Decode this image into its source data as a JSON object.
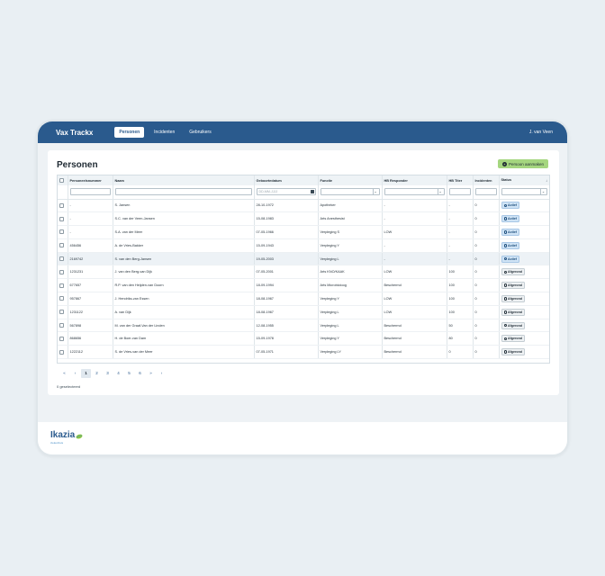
{
  "header": {
    "brand": "Vax Trackx",
    "tabs": [
      {
        "label": "Personen",
        "active": true
      },
      {
        "label": "Incidenten",
        "active": false
      },
      {
        "label": "Gebruikers",
        "active": false
      }
    ],
    "user": "J. van Veen"
  },
  "page": {
    "title": "Personen",
    "add_button": "Persoon aanmaken"
  },
  "table": {
    "columns": [
      "Personeelsnummer",
      "Naam",
      "Geboortedatum",
      "Functie",
      "HB Responder",
      "HB Titer",
      "Incidenten",
      "Status"
    ],
    "filters": {
      "date_placeholder": "DD-MM-JJJJ"
    },
    "rows": [
      {
        "nr": "-",
        "naam": "S. Jansen",
        "geb": "28-10-1972",
        "functie": "Apotheker",
        "hb": "-",
        "titer": "-",
        "inc": "0",
        "status": "Actief"
      },
      {
        "nr": "-",
        "naam": "S.C. van der Veen-Jansen",
        "geb": "15-08-1983",
        "functie": "Arts Anesthesist",
        "hb": "-",
        "titer": "-",
        "inc": "0",
        "status": "Actief"
      },
      {
        "nr": "-",
        "naam": "S.A. van der Meer",
        "geb": "07-05-1966",
        "functie": "Verpleging S",
        "hb": "LOW",
        "titer": "-",
        "inc": "0",
        "status": "Actief"
      },
      {
        "nr": "456456",
        "naam": "A. de Vries-Bakker",
        "geb": "15-09-1943",
        "functie": "Verpleging Y",
        "hb": "-",
        "titer": "-",
        "inc": "0",
        "status": "Actief"
      },
      {
        "nr": "2169742",
        "naam": "S. van den Berg-Jansen",
        "geb": "19-05-2003",
        "functie": "Verpleging L",
        "hb": "-",
        "titer": "-",
        "inc": "0",
        "status": "Actief"
      },
      {
        "nr": "1231231",
        "naam": "J. van den Berg-van Dijk",
        "geb": "07-05-2001",
        "functie": "Arts KNO/KAAK",
        "hb": "LOW",
        "titer": "100",
        "inc": "0",
        "status": "Afgerond"
      },
      {
        "nr": "677657",
        "naam": "R.P. van den Heijden-van Doorn",
        "geb": "18-09-1994",
        "functie": "Arts Microbioloog",
        "hb": "Beschermd",
        "titer": "100",
        "inc": "0",
        "status": "Afgerond"
      },
      {
        "nr": "957867",
        "naam": "J. Hendriks-van Essen",
        "geb": "18-08-1967",
        "functie": "Verpleging Y",
        "hb": "LOW",
        "titer": "100",
        "inc": "0",
        "status": "Afgerond"
      },
      {
        "nr": "1231122",
        "naam": "A. van Dijk",
        "geb": "18-08-1967",
        "functie": "Verpleging L",
        "hb": "LOW",
        "titer": "100",
        "inc": "0",
        "status": "Afgerond"
      },
      {
        "nr": "567898",
        "naam": "M. van der Graaf-Van der Linden",
        "geb": "12-08-1955",
        "functie": "Verpleging L",
        "hb": "Beschermd",
        "titer": "50",
        "inc": "0",
        "status": "Afgerond"
      },
      {
        "nr": "868656",
        "naam": "H. de Boer-van Dam",
        "geb": "15-09-1978",
        "functie": "Verpleging Y",
        "hb": "Beschermd",
        "titer": "80",
        "inc": "0",
        "status": "Afgerond"
      },
      {
        "nr": "1222112",
        "naam": "S. de Vries-van der Meer",
        "geb": "07-05-1971",
        "functie": "Verpleging LY",
        "hb": "Beschermd",
        "titer": "0",
        "inc": "0",
        "status": "Afgerond"
      }
    ]
  },
  "pagination": {
    "first": "«",
    "prev": "‹",
    "pages": [
      "1",
      "2",
      "3",
      "4",
      "5",
      "6"
    ],
    "current": "1",
    "next": "»",
    "last": "›"
  },
  "selection": {
    "count_text": "0 geselecteerd"
  },
  "footer": {
    "logo_text": "Ikazia",
    "logo_sub": "ziekenhuis"
  },
  "colors": {
    "primary": "#2a5a8d",
    "accent_green": "#a5d67f",
    "status_active": "#cfe3f5"
  }
}
